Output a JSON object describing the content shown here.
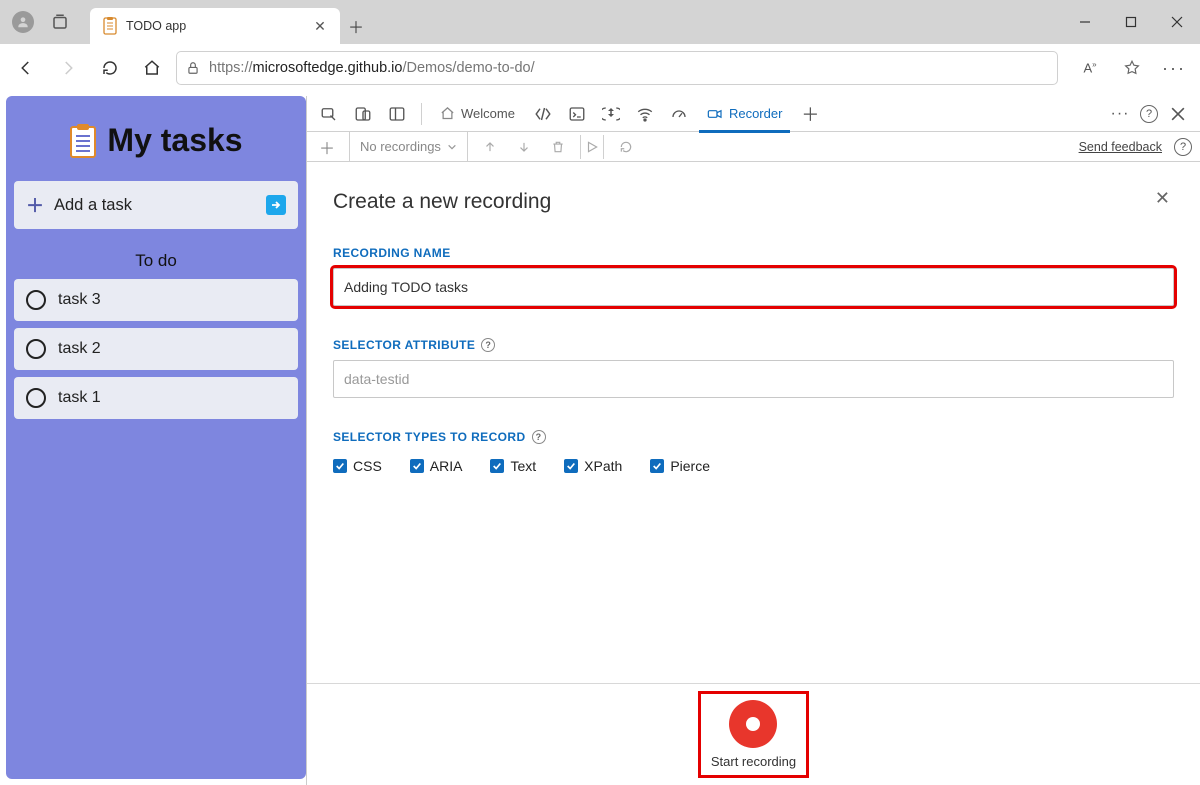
{
  "browser": {
    "tab_title": "TODO app",
    "url_scheme": "https://",
    "url_host": "microsoftedge.github.io",
    "url_path": "/Demos/demo-to-do/"
  },
  "window_controls": {
    "minimize": "minimize",
    "maximize": "maximize",
    "close": "close"
  },
  "app": {
    "title": "My tasks",
    "add_task_label": "Add a task",
    "section": "To do",
    "tasks": [
      "task 3",
      "task 2",
      "task 1"
    ]
  },
  "devtools": {
    "tabs": {
      "welcome": "Welcome",
      "recorder": "Recorder"
    },
    "toolbar": {
      "dropdown": "No recordings",
      "more_icon": "more",
      "help_icon": "help",
      "close_icon": "close"
    },
    "sub_toolbar": {
      "feedback": "Send feedback"
    },
    "form": {
      "heading": "Create a new recording",
      "close": "✕",
      "labels": {
        "name": "RECORDING NAME",
        "selector_attr": "SELECTOR ATTRIBUTE",
        "selector_types": "SELECTOR TYPES TO RECORD"
      },
      "name_value": "Adding TODO tasks",
      "selector_placeholder": "data-testid",
      "checkboxes": [
        "CSS",
        "ARIA",
        "Text",
        "XPath",
        "Pierce"
      ],
      "start_label": "Start recording"
    }
  }
}
